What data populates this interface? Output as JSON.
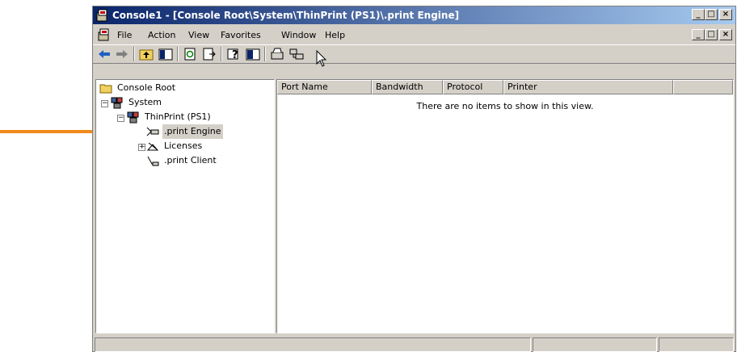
{
  "window": {
    "title": "Console1 - [Console Root\\System\\ThinPrint (PS1)\\.print Engine]",
    "minimize_glyph": "_",
    "maximize_glyph": "□",
    "close_glyph": "×",
    "restore_glyph": "🗗"
  },
  "menu": {
    "items": [
      "File",
      "Action",
      "View",
      "Favorites",
      "Window",
      "Help"
    ]
  },
  "tree": {
    "root": "Console Root",
    "system": "System",
    "thinprint": "ThinPrint (PS1)",
    "engine": ".print Engine",
    "licenses": "Licenses",
    "client": ".print Client"
  },
  "list": {
    "columns": [
      "Port Name",
      "Bandwidth",
      "Protocol",
      "Printer"
    ],
    "empty_message": "There are no items to show in this view."
  },
  "colors": {
    "title_gradient_start": "#0a246a",
    "title_gradient_end": "#a6caf0",
    "arrow": "#f28a1a",
    "chrome": "#d4d0c8"
  }
}
